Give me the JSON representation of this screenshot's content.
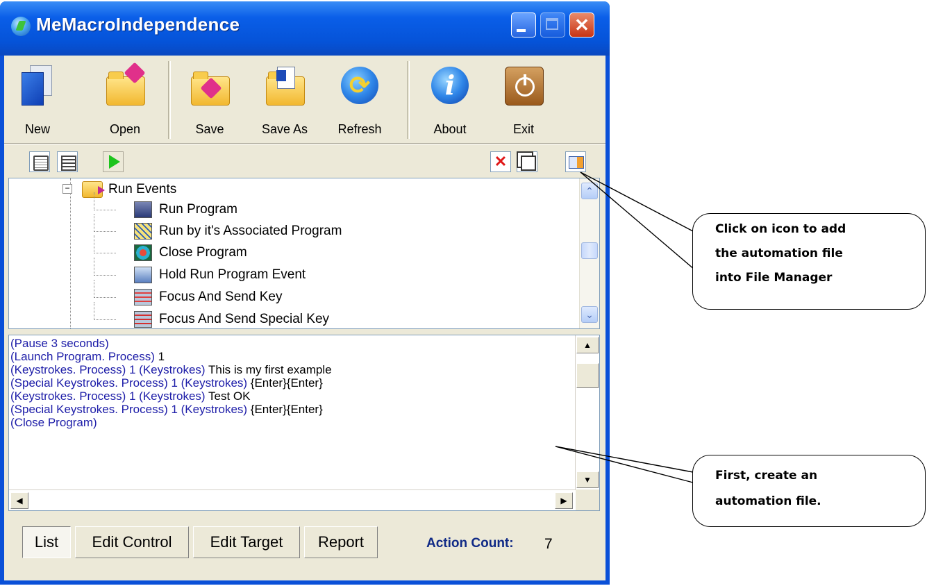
{
  "window": {
    "title": "MeMacroIndependence",
    "controls": {
      "minimize": "minimize-icon",
      "maximize": "maximize-icon",
      "close": "✕"
    }
  },
  "toolbar": {
    "new": "New",
    "open": "Open",
    "save": "Save",
    "save_as": "Save As",
    "refresh": "Refresh",
    "about": "About",
    "exit": "Exit"
  },
  "small_toolbar": {
    "icons": [
      "properties-icon",
      "list-view-icon",
      "play-icon",
      "delete-icon",
      "copy-icon",
      "add-to-file-manager-icon"
    ]
  },
  "tree": {
    "group": {
      "expander": "−",
      "label": "Run Events"
    },
    "items": [
      "Run Program",
      "Run by it's Associated Program",
      "Close Program",
      "Hold Run Program Event",
      "Focus And Send Key",
      "Focus And Send Special Key"
    ]
  },
  "actions": [
    {
      "tag": "(Pause 3 seconds)",
      "value": ""
    },
    {
      "tag": "(Launch Program. Process)",
      "value": " 1"
    },
    {
      "tag": "(Keystrokes.  Process) 1 (Keystrokes)",
      "value": " This is my first example"
    },
    {
      "tag": "(Special Keystrokes. Process) 1 (Keystrokes)",
      "value": " {Enter}{Enter}"
    },
    {
      "tag": "(Keystrokes.  Process) 1 (Keystrokes)",
      "value": " Test OK"
    },
    {
      "tag": "(Special Keystrokes. Process) 1 (Keystrokes)",
      "value": " {Enter}{Enter}"
    },
    {
      "tag": "(Close Program)",
      "value": ""
    }
  ],
  "scroll_arrows": {
    "up": "▲",
    "down": "▼",
    "left": "◀",
    "right": "▶"
  },
  "tree_scroll_arrows": {
    "up": "⌃",
    "down": "⌄"
  },
  "bottom": {
    "tabs": [
      "List",
      "Edit Control",
      "Edit Target",
      "Report"
    ],
    "active_tab": "List",
    "count_label": "Action Count:",
    "count_value": "7"
  },
  "callouts": {
    "add_file": {
      "line1": "Click on icon to add",
      "line2": "the automation file",
      "line3": "into File Manager"
    },
    "create_file": {
      "line1": "First, create an",
      "line2": "automation file."
    }
  }
}
